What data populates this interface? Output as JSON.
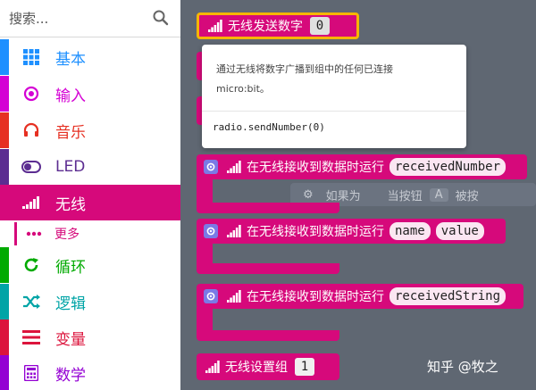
{
  "search": {
    "placeholder": "搜索..."
  },
  "categories": [
    {
      "label": "基本",
      "icon": "grid-icon",
      "color": "#1e90ff"
    },
    {
      "label": "输入",
      "icon": "target-icon",
      "color": "#d400d4"
    },
    {
      "label": "音乐",
      "icon": "headphones-icon",
      "color": "#e63022"
    },
    {
      "label": "LED",
      "icon": "toggle-icon",
      "color": "#5c2d91"
    },
    {
      "label": "无线",
      "icon": "signal-icon",
      "color": "#d6097b"
    },
    {
      "label": "循环",
      "icon": "loop-icon",
      "color": "#00aa00"
    },
    {
      "label": "逻辑",
      "icon": "shuffle-icon",
      "color": "#00a4a6"
    },
    {
      "label": "变量",
      "icon": "lines-icon",
      "color": "#dc143c"
    },
    {
      "label": "数学",
      "icon": "calculator-icon",
      "color": "#9400d3"
    }
  ],
  "subcategory": {
    "label": "更多"
  },
  "blocks": {
    "send_number": {
      "label": "无线发送数字",
      "value": "0"
    },
    "on_received_number": {
      "label": "在无线接收到数据时运行",
      "param": "receivedNumber"
    },
    "on_received_value": {
      "label": "在无线接收到数据时运行",
      "param1": "name",
      "param2": "value"
    },
    "on_received_string": {
      "label": "在无线接收到数据时运行",
      "param": "receivedString"
    },
    "set_group": {
      "label": "无线设置组",
      "value": "1"
    }
  },
  "tooltip": {
    "line1": "通过无线将数字广播到组中的任何已连接",
    "line2": "micro:bit。",
    "code": "radio.sendNumber(0)"
  },
  "ghost_block": {
    "if_label": "如果为",
    "pressed_label": "当按钮",
    "button": "A",
    "pressed_suffix": "被按"
  },
  "watermark": "知乎 @牧之",
  "colors": {
    "radio": "#d6097b",
    "workspace": "#5f6772"
  }
}
